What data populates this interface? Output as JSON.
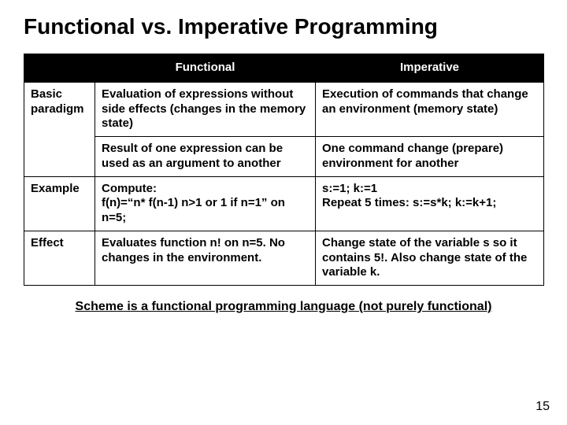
{
  "title": "Functional vs. Imperative Programming",
  "headers": {
    "col1": "Functional",
    "col2": "Imperative"
  },
  "rows": {
    "basic": {
      "label": "Basic paradigm",
      "func": "Evaluation of expressions without side effects (changes in the memory state)",
      "imp": "Execution of commands that change an environment (memory state)"
    },
    "basic2": {
      "func": "Result of one expression can be used as an argument to another",
      "imp": "One command change (prepare) environment for another"
    },
    "example": {
      "label": "Example",
      "func": "Compute:\n f(n)=“n* f(n-1) n>1 or 1 if n=1” on n=5;",
      "imp": "s:=1; k:=1\nRepeat 5 times: s:=s*k; k:=k+1;"
    },
    "effect": {
      "label": "Effect",
      "func": "Evaluates function n! on n=5. No changes in the environment.",
      "imp": "Change state of the variable s so it contains 5!. Also change state of the variable k."
    }
  },
  "footnote": "Scheme is a functional programming language (not purely functional)",
  "page_number": "15"
}
